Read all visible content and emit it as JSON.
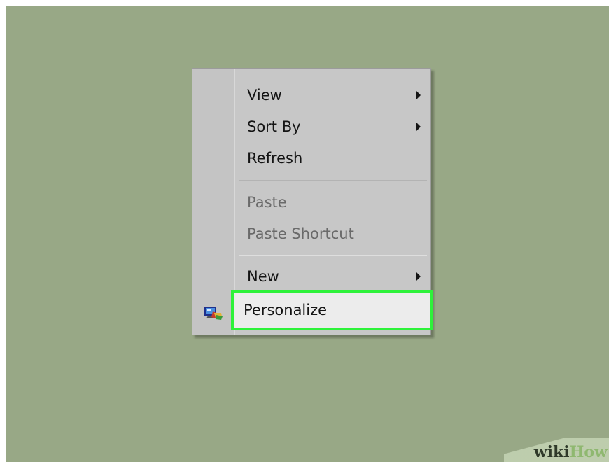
{
  "context_menu": {
    "items": [
      {
        "label": "View",
        "has_submenu": true,
        "enabled": true
      },
      {
        "label": "Sort By",
        "has_submenu": true,
        "enabled": true
      },
      {
        "label": "Refresh",
        "has_submenu": false,
        "enabled": true
      },
      {
        "label": "Paste",
        "has_submenu": false,
        "enabled": false
      },
      {
        "label": "Paste Shortcut",
        "has_submenu": false,
        "enabled": false
      },
      {
        "label": "New",
        "has_submenu": true,
        "enabled": true
      },
      {
        "label": "Personalize",
        "has_submenu": false,
        "enabled": true,
        "highlighted": true,
        "icon": "personalize-icon"
      }
    ]
  },
  "watermark": {
    "wiki": "wiki",
    "how": "How"
  },
  "colors": {
    "desktop": "#98a886",
    "menu_background": "#c7c7c7",
    "highlight_border": "#2ef23a",
    "disabled_text": "#6a6a6a"
  }
}
